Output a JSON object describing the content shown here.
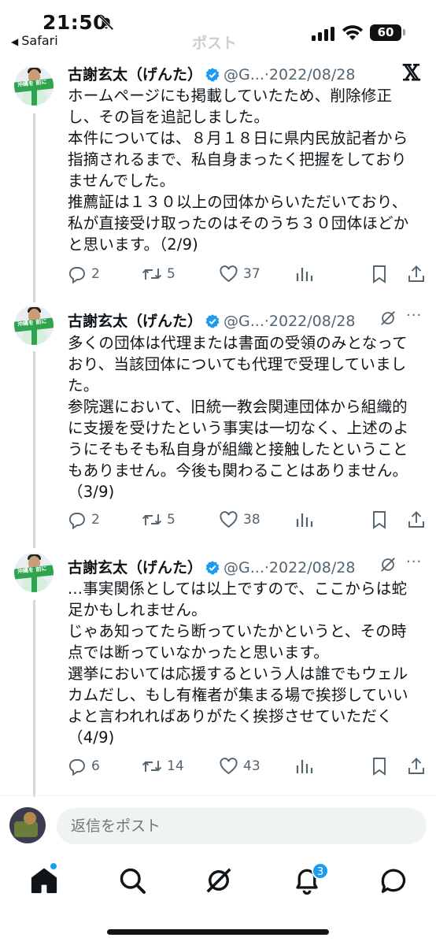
{
  "status_bar": {
    "time": "21:50",
    "back_app": "Safari",
    "battery": "60",
    "header_ghost": "ポスト"
  },
  "tweets": [
    {
      "name": "古謝玄太（げんた）",
      "handle": "@G...",
      "date": "·2022/08/28",
      "body": "ホームページにも掲載していたため、削除修正\nし、その旨を追記しました。\n本件については、８月１８日に県内民放記者から\n指摘されるまで、私自身まったく把握をしており\nませんでした。\n推薦証は１３０以上の団体からいただいており、\n私が直接受け取ったのはそのうち３０団体ほどか\nと思います。（2/9)",
      "replies": "2",
      "reposts": "5",
      "likes": "37"
    },
    {
      "name": "古謝玄太（げんた）",
      "handle": "@G...",
      "date": "·2022/08/28",
      "body": "多くの団体は代理または書面の受領のみとなって\nおり、当該団体についても代理で受理していまし\nた。\n参院選において、旧統一教会関連団体から組織的\nに支援を受けたという事実は一切なく、上述のよ\nうにそもそも私自身が組織と接触したということ\nもありません。今後も関わることはありません。\n（3/9)",
      "replies": "2",
      "reposts": "5",
      "likes": "38"
    },
    {
      "name": "古謝玄太（げんた）",
      "handle": "@G...",
      "date": "·2022/08/28",
      "body": "...事実関係としては以上ですので、ここからは蛇\n足かもしれません。\nじゃあ知ってたら断っていたかというと、その時\n点では断っていなかったと思います。\n選挙においては応援するという人は誰でもウェル\nカムだし、もし有権者が集まる場で挨拶していい\nよと言われればありがたく挨拶させていただく\n（4/9)",
      "replies": "6",
      "reposts": "14",
      "likes": "43"
    }
  ],
  "reply": {
    "placeholder": "返信をポスト"
  },
  "tabbar": {
    "notifications_badge": "3"
  },
  "colors": {
    "accent": "#1d9bf0",
    "text": "#0f1419",
    "secondary": "#536471",
    "thread_line": "#cfd9de"
  }
}
